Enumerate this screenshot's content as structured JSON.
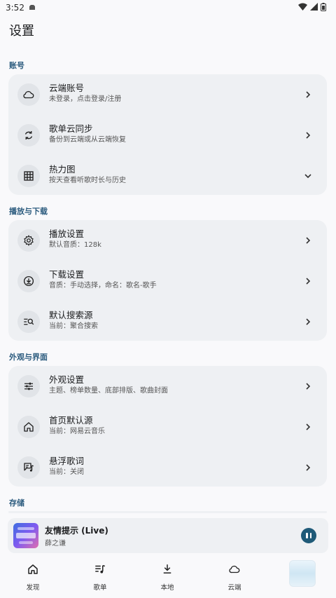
{
  "status_bar": {
    "time": "3:52"
  },
  "page": {
    "title": "设置"
  },
  "sections": [
    {
      "label": "账号",
      "items": [
        {
          "icon": "cloud-icon",
          "title": "云端账号",
          "subtitle": "未登录，点击登录/注册",
          "trail": "chevron-right"
        },
        {
          "icon": "sync-icon",
          "title": "歌单云同步",
          "subtitle": "备份到云端或从云端恢复",
          "trail": "chevron-right"
        },
        {
          "icon": "grid-icon",
          "title": "热力图",
          "subtitle": "按天查看听歌时长与历史",
          "trail": "chevron-down"
        }
      ]
    },
    {
      "label": "播放与下载",
      "items": [
        {
          "icon": "gear-icon",
          "title": "播放设置",
          "subtitle": "默认音质：128k",
          "trail": "chevron-right"
        },
        {
          "icon": "download-icon",
          "title": "下载设置",
          "subtitle": "音质：手动选择，命名：歌名-歌手",
          "trail": "chevron-right"
        },
        {
          "icon": "search-list-icon",
          "title": "默认搜索源",
          "subtitle": "当前：聚合搜索",
          "trail": "chevron-right"
        }
      ]
    },
    {
      "label": "外观与界面",
      "items": [
        {
          "icon": "tune-icon",
          "title": "外观设置",
          "subtitle": "主题、榜单数量、底部排版、歌曲封面",
          "trail": "chevron-right"
        },
        {
          "icon": "home-icon",
          "title": "首页默认源",
          "subtitle": "当前：网易云音乐",
          "trail": "chevron-right"
        },
        {
          "icon": "lyrics-icon",
          "title": "悬浮歌词",
          "subtitle": "当前：关闭",
          "trail": "chevron-right"
        }
      ]
    },
    {
      "label": "存储",
      "items": []
    }
  ],
  "now_playing": {
    "title": "友情提示 (Live)",
    "artist": "薛之谦"
  },
  "bottom_nav": [
    {
      "icon": "home-outline-icon",
      "label": "发现"
    },
    {
      "icon": "playlist-icon",
      "label": "歌单"
    },
    {
      "icon": "download-tray-icon",
      "label": "本地"
    },
    {
      "icon": "cloud-outline-icon",
      "label": "云端"
    }
  ],
  "colors": {
    "accent": "#2b5b7e",
    "card": "#eef0f3",
    "background": "#f9f9fb",
    "play_button": "#1f5a78"
  }
}
